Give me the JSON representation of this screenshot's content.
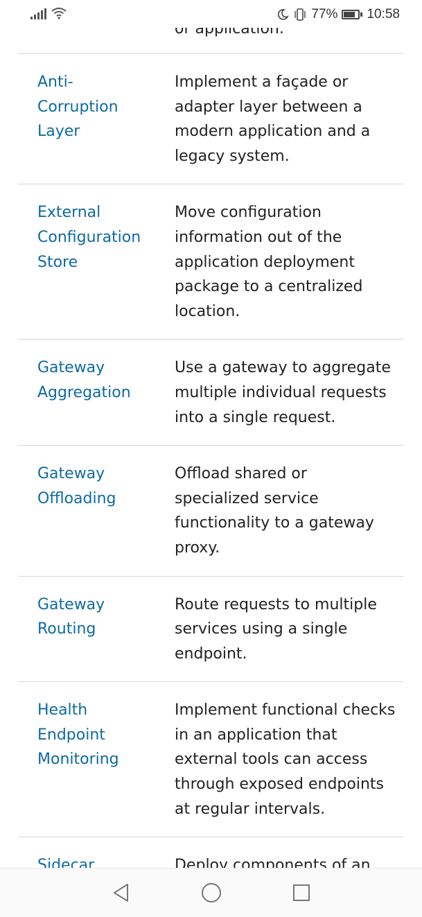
{
  "status_bar": {
    "battery_percent": "77%",
    "time": "10:58",
    "icons": [
      "signal-icon",
      "wifi-icon",
      "moon-icon",
      "vibrate-icon",
      "battery-icon"
    ]
  },
  "clipped_row": {
    "text": "or application."
  },
  "patterns": [
    {
      "name_lines": [
        "Anti-",
        "Corruption",
        "Layer"
      ],
      "desc_lines": [
        "Implement a façade or",
        "adapter layer between a",
        "modern application and a",
        "legacy system."
      ]
    },
    {
      "name_lines": [
        "External",
        "Configuration",
        "Store"
      ],
      "desc_lines": [
        "Move configuration",
        "information out of the",
        "application deployment",
        "package to a centralized",
        "location."
      ]
    },
    {
      "name_lines": [
        "Gateway",
        "Aggregation"
      ],
      "desc_lines": [
        "Use a gateway to aggregate",
        "multiple individual requests",
        "into a single request."
      ]
    },
    {
      "name_lines": [
        "Gateway",
        "Offloading"
      ],
      "desc_lines": [
        "Offload shared or",
        "specialized service",
        "functionality to a gateway",
        "proxy."
      ]
    },
    {
      "name_lines": [
        "Gateway",
        "Routing"
      ],
      "desc_lines": [
        "Route requests to multiple",
        "services using a single",
        "endpoint."
      ]
    },
    {
      "name_lines": [
        "Health",
        "Endpoint",
        "Monitoring"
      ],
      "desc_lines": [
        "Implement functional checks",
        "in an application that",
        "external tools can access",
        "through exposed endpoints",
        "at regular intervals."
      ]
    },
    {
      "name_lines": [
        "Sidecar"
      ],
      "desc_lines": [
        "Deploy components of an"
      ]
    }
  ],
  "nav_bar": {
    "buttons": [
      "back-icon",
      "home-icon",
      "recents-icon"
    ]
  },
  "colors": {
    "link": "#0e6aa3",
    "text": "#222222",
    "divider": "#d6d6d6"
  }
}
